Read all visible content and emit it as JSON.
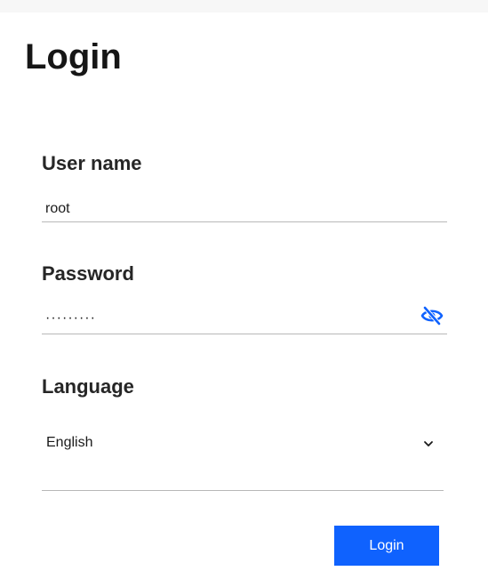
{
  "page": {
    "title": "Login"
  },
  "form": {
    "username": {
      "label": "User name",
      "value": "root"
    },
    "password": {
      "label": "Password",
      "masked_value": "·········",
      "toggle_icon": "eye-slash-icon"
    },
    "language": {
      "label": "Language",
      "selected": "English",
      "icon": "chevron-down-icon"
    },
    "submit_label": "Login"
  },
  "colors": {
    "accent": "#0f62fe",
    "text": "#1a1a1a",
    "underline": "#b8b8b8"
  }
}
